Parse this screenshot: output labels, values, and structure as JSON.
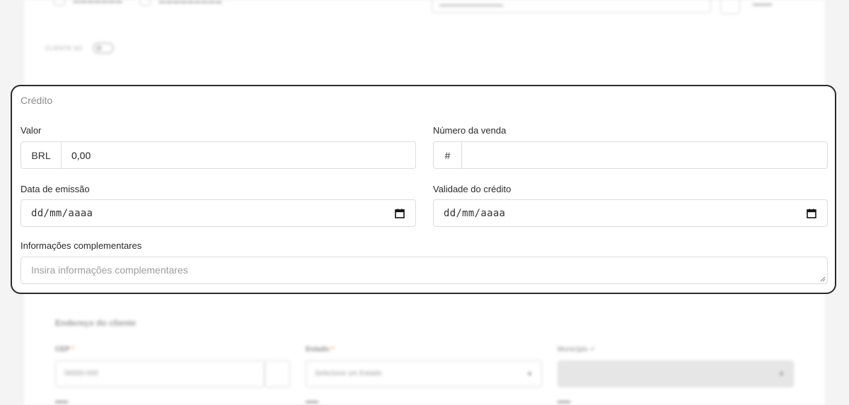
{
  "credito": {
    "section_title": "Crédito",
    "valor": {
      "label": "Valor",
      "currency": "BRL",
      "value": "0,00"
    },
    "numero_venda": {
      "label": "Número da venda",
      "prefix": "#",
      "value": ""
    },
    "data_emissao": {
      "label": "Data de emissão",
      "placeholder": "dd/mm/aaaa",
      "icon": "calendar-icon"
    },
    "validade": {
      "label": "Validade do crédito",
      "placeholder": "dd/mm/aaaa",
      "icon": "calendar-icon"
    },
    "info": {
      "label": "Informações complementares",
      "placeholder": "Insira informações complementares"
    }
  },
  "background": {
    "toggle_label": "CLIENTE NO",
    "address_title": "Endereço do cliente",
    "cep": {
      "label": "CEP",
      "placeholder": "00000-000"
    },
    "estado": {
      "label": "Estado",
      "placeholder": "Selecione um Estado"
    },
    "municipio": {
      "label": "Município"
    }
  }
}
